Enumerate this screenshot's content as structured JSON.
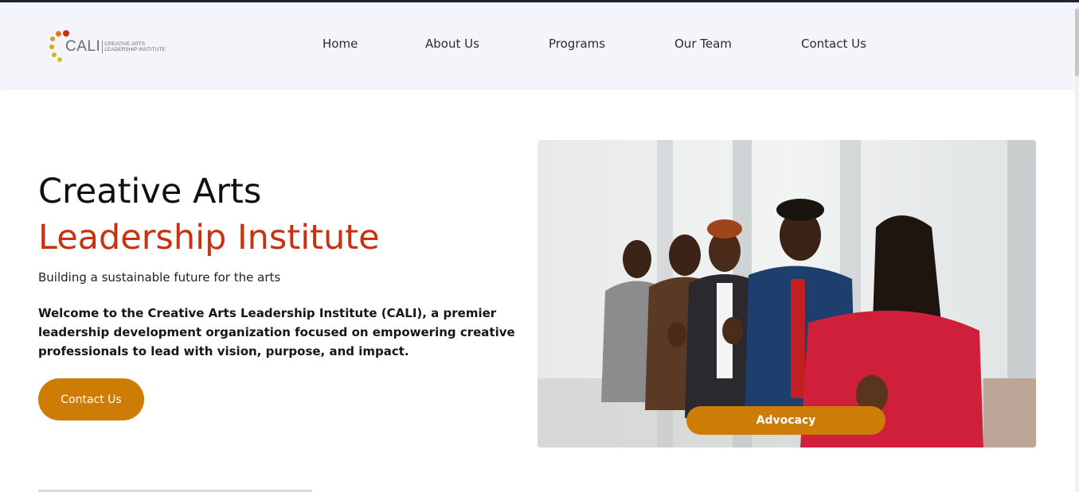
{
  "logo": {
    "abbr": "CALI",
    "line1": "Creative Arts",
    "line2": "Leadership Institute",
    "colors": [
      "#e07a1c",
      "#d9a51a",
      "#c9c51a",
      "#c8330f"
    ]
  },
  "nav": {
    "items": [
      {
        "label": "Home"
      },
      {
        "label": "About Us"
      },
      {
        "label": "Programs"
      },
      {
        "label": "Our Team"
      },
      {
        "label": "Contact Us"
      }
    ]
  },
  "hero": {
    "title_line1": "Creative Arts",
    "title_line2": "Leadership Institute",
    "tagline": "Building a sustainable future for the arts",
    "intro": "Welcome to the Creative Arts Leadership Institute (CALI), a premier leadership development organization focused on empowering creative professionals to lead with vision, purpose, and impact.",
    "cta_label": "Contact Us",
    "image_badge": "Advocacy"
  },
  "colors": {
    "accent": "#cd7d05",
    "title_red": "#c8330f",
    "header_bg": "#f4f5fb"
  }
}
